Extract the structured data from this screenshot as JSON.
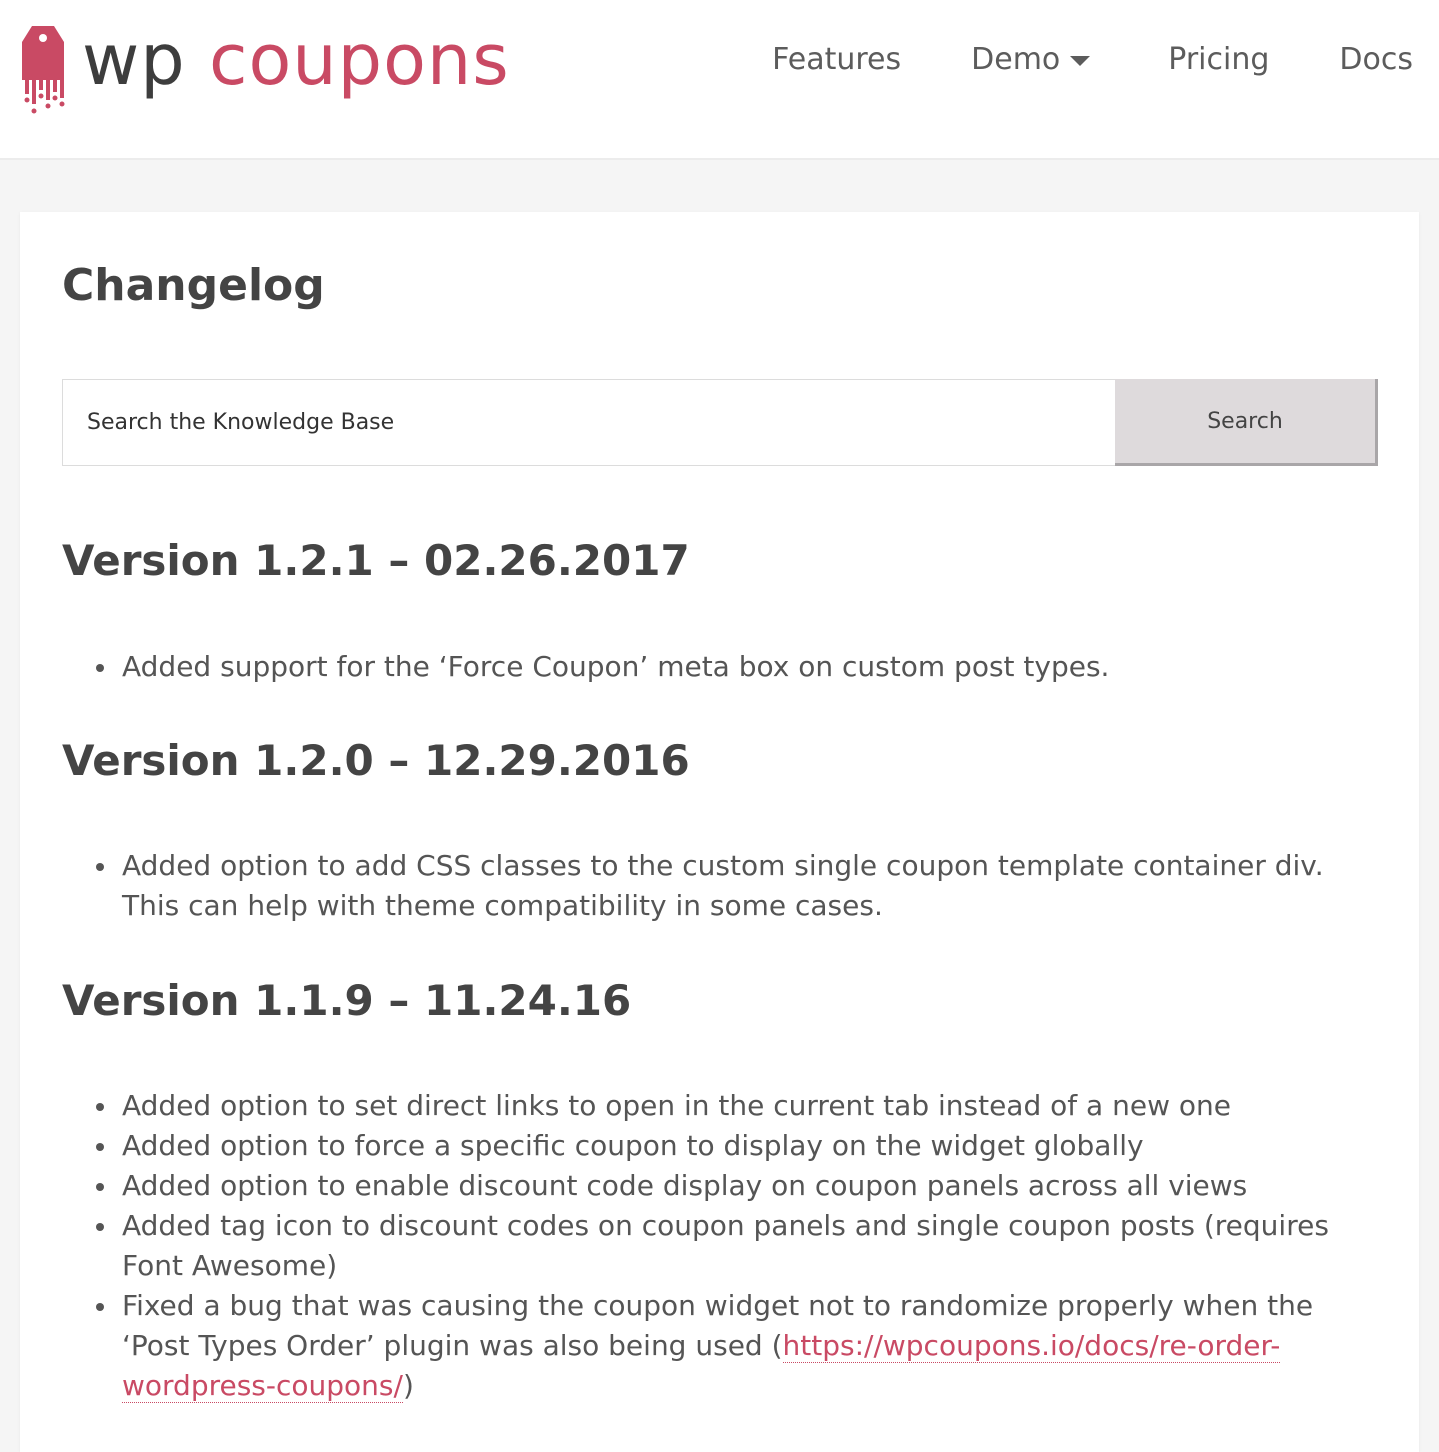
{
  "header": {
    "logo": {
      "wp": "wp",
      "coupons": "coupons"
    },
    "nav": [
      {
        "label": "Features"
      },
      {
        "label": "Demo",
        "has_dropdown": true
      },
      {
        "label": "Pricing"
      },
      {
        "label": "Docs"
      }
    ]
  },
  "page": {
    "title": "Changelog",
    "search": {
      "placeholder": "Search the Knowledge Base",
      "button_label": "Search"
    },
    "versions": [
      {
        "heading": "Version 1.2.1 – 02.26.2017",
        "items": [
          "Added support for the ‘Force Coupon’ meta box on custom post types."
        ]
      },
      {
        "heading": "Version 1.2.0 – 12.29.2016",
        "items": [
          "Added option to add CSS classes to the custom single coupon template container div. This can help with theme compatibility in some cases."
        ]
      },
      {
        "heading": "Version 1.1.9 – 11.24.16",
        "items": [
          "Added option to set direct links to open in the current tab instead of a new one",
          "Added option to force a specific coupon to display on the widget globally",
          "Added option to enable discount code display on coupon panels across all views",
          "Added tag icon to discount codes on coupon panels and single coupon posts (requires Font Awesome)"
        ],
        "last_item": {
          "text_before": "Fixed a bug that was causing the coupon widget not to randomize properly when the ‘Post Types Order’ plugin was also being used (",
          "link_text": "https://wpcoupons.io/docs/re-order-wordpress-coupons/",
          "text_after": ")"
        }
      }
    ]
  },
  "colors": {
    "brand": "#c94a64",
    "text": "#444444",
    "background": "#f5f5f5"
  }
}
